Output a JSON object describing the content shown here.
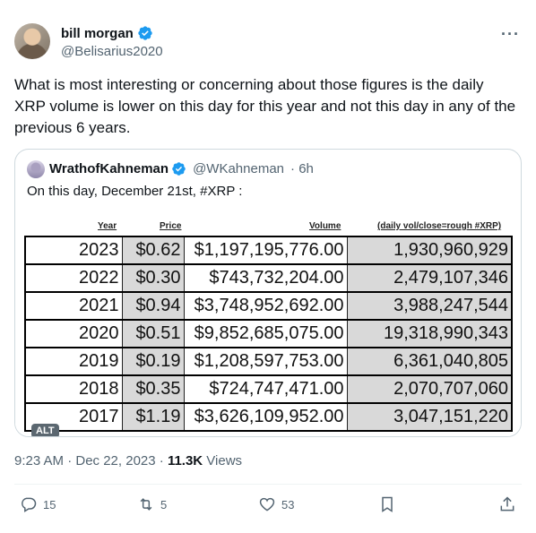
{
  "author": {
    "name": "bill morgan",
    "handle": "@Belisarius2020"
  },
  "more_label": "···",
  "tweet_text": "What is most interesting or concerning about those figures is the daily XRP volume is lower on this day for this year and not this day in any of the previous 6 years.",
  "quote": {
    "name": "WrathofKahneman",
    "handle": "@WKahneman",
    "time": "· 6h",
    "text": "On this day, December 21st, #XRP :",
    "table": {
      "headers": {
        "year": "Year",
        "price": "Price",
        "volume": "Volume",
        "ratio": "(daily vol/close=rough #XRP)"
      },
      "rows": [
        {
          "year": "2023",
          "price": "$0.62",
          "volume": "$1,197,195,776.00",
          "ratio": "1,930,960,929"
        },
        {
          "year": "2022",
          "price": "$0.30",
          "volume": "$743,732,204.00",
          "ratio": "2,479,107,346"
        },
        {
          "year": "2021",
          "price": "$0.94",
          "volume": "$3,748,952,692.00",
          "ratio": "3,988,247,544"
        },
        {
          "year": "2020",
          "price": "$0.51",
          "volume": "$9,852,685,075.00",
          "ratio": "19,318,990,343"
        },
        {
          "year": "2019",
          "price": "$0.19",
          "volume": "$1,208,597,753.00",
          "ratio": "6,361,040,805"
        },
        {
          "year": "2018",
          "price": "$0.35",
          "volume": "$724,747,471.00",
          "ratio": "2,070,707,060"
        },
        {
          "year": "2017",
          "price": "$1.19",
          "volume": "$3,626,109,952.00",
          "ratio": "3,047,151,220"
        }
      ]
    },
    "alt_badge": "ALT"
  },
  "meta": {
    "time": "9:23 AM · Dec 22, 2023 · ",
    "views_count": "11.3K",
    "views_label": " Views"
  },
  "actions": {
    "replies": "15",
    "reposts": "5",
    "likes": "53"
  },
  "colors": {
    "verified": "#1d9bf0",
    "text_secondary": "#536471",
    "cell_gray": "#d9d9d9"
  }
}
